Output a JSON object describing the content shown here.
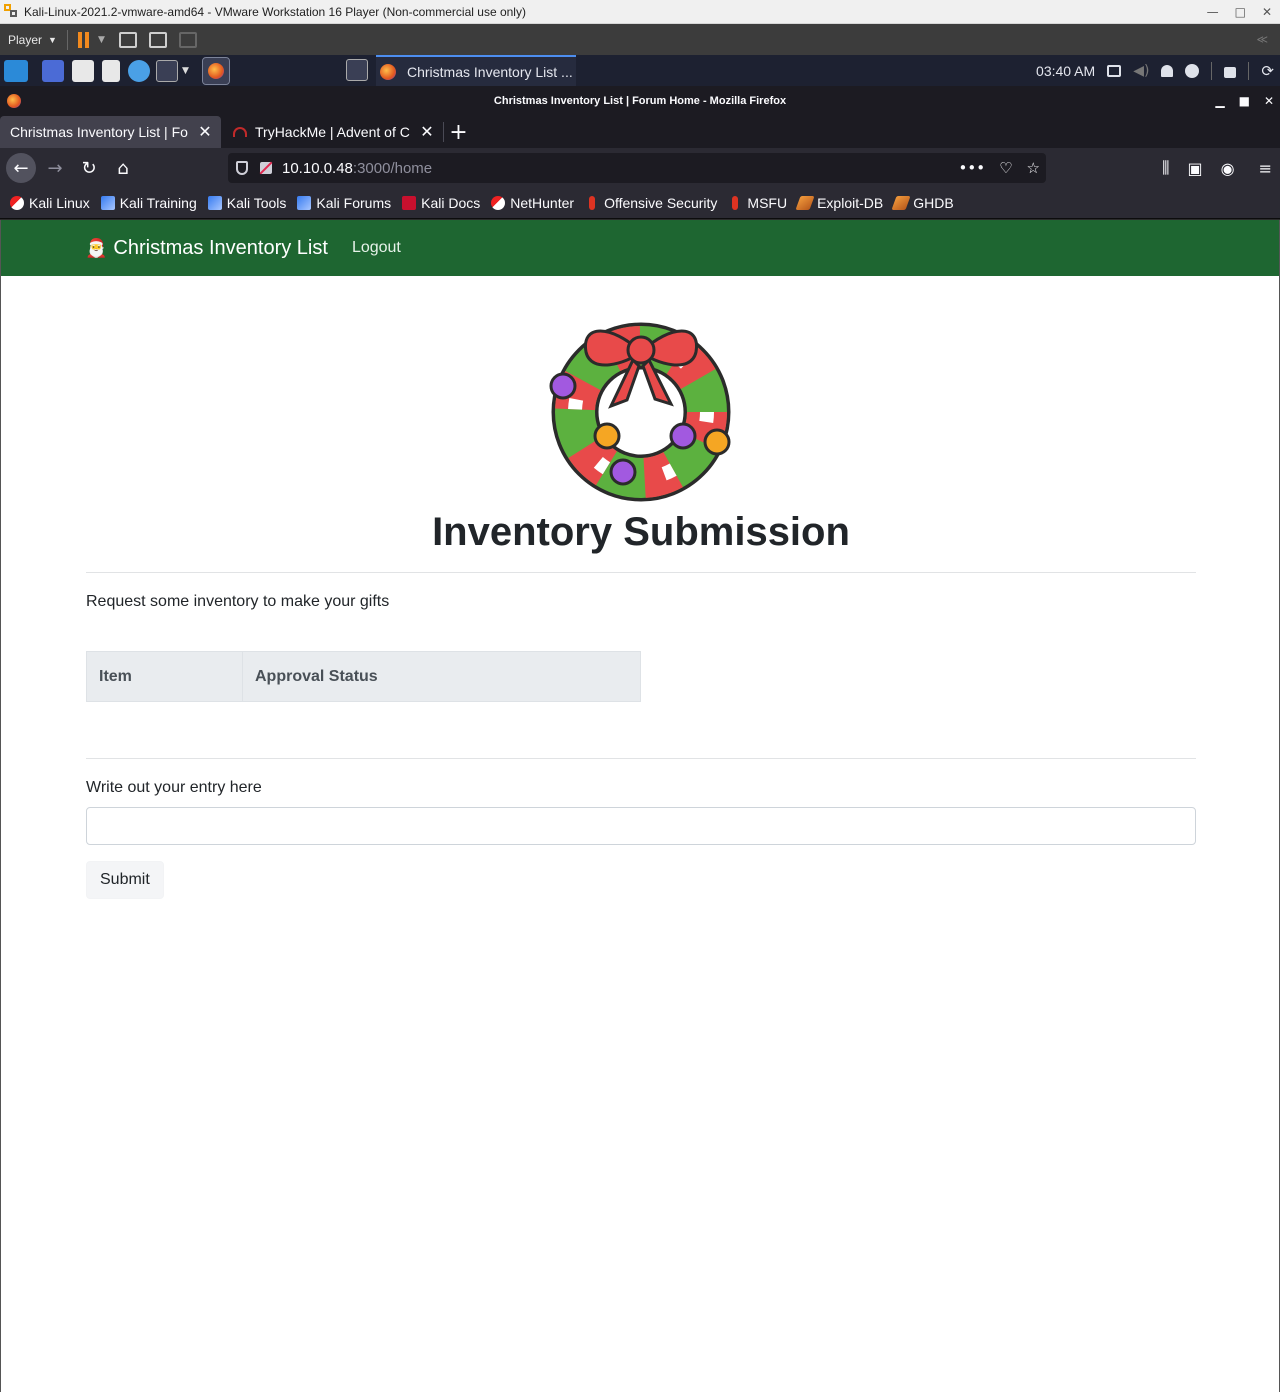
{
  "vmware": {
    "title": "Kali-Linux-2021.2-vmware-amd64 - VMware Workstation 16 Player (Non-commercial use only)",
    "player_menu": "Player",
    "collapse": "≪"
  },
  "kali_panel": {
    "task_label": "Christmas Inventory List ...",
    "clock": "03:40 AM"
  },
  "firefox": {
    "window_title": "Christmas Inventory List | Forum Home - Mozilla Firefox",
    "tabs": [
      {
        "label": "Christmas Inventory List | Fo",
        "active": true
      },
      {
        "label": "TryHackMe | Advent of C",
        "active": false
      }
    ],
    "url_host": "10.10.0.48",
    "url_path": ":3000/home",
    "bookmarks": [
      {
        "label": "Kali Linux",
        "icon": "kali-dragon-icon"
      },
      {
        "label": "Kali Training",
        "icon": "kali-training-icon"
      },
      {
        "label": "Kali Tools",
        "icon": "kali-training-icon"
      },
      {
        "label": "Kali Forums",
        "icon": "kali-training-icon"
      },
      {
        "label": "Kali Docs",
        "icon": "kali-docs-icon"
      },
      {
        "label": "NetHunter",
        "icon": "nethunter-icon"
      },
      {
        "label": "Offensive Security",
        "icon": "offsec-icon"
      },
      {
        "label": "MSFU",
        "icon": "offsec-icon"
      },
      {
        "label": "Exploit-DB",
        "icon": "exploitdb-icon"
      },
      {
        "label": "GHDB",
        "icon": "exploitdb-icon"
      }
    ]
  },
  "site": {
    "brand": "Christmas Inventory List",
    "logout": "Logout",
    "heading": "Inventory Submission",
    "lead": "Request some inventory to make your gifts",
    "table_headers": [
      "Item",
      "Approval Status"
    ],
    "entry_label": "Write out your entry here",
    "entry_value": "",
    "submit_label": "Submit"
  },
  "colors": {
    "site_nav": "#1e6631",
    "ff_tab_active": "#42414d",
    "kali_panel": "#1d2131"
  }
}
